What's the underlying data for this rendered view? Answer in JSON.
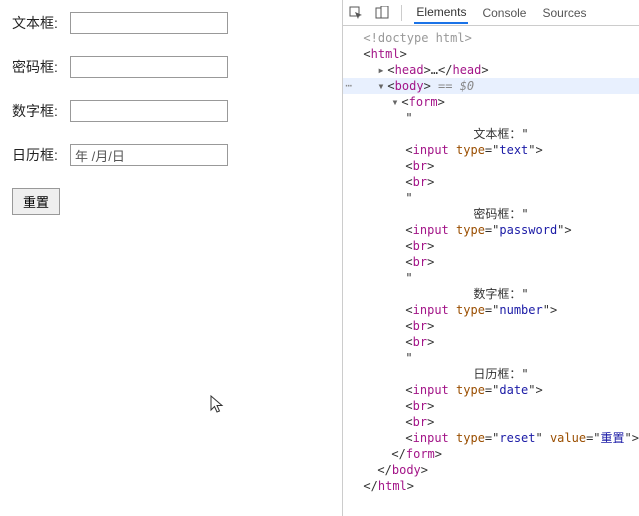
{
  "form": {
    "labels": {
      "text": "文本框:",
      "password": "密码框:",
      "number": "数字框:",
      "date": "日历框:"
    },
    "date_placeholder": "年 /月/日",
    "reset_label": "重置"
  },
  "devtools": {
    "tabs": {
      "elements": "Elements",
      "console": "Console",
      "sources": "Sources"
    },
    "tree": {
      "doctype": "<!doctype html>",
      "html_open": "html",
      "head_open": "head",
      "head_ellipsis": "…",
      "head_close": "head",
      "body_open": "body",
      "eq0": " == $0",
      "form_open": "form",
      "quote": "\"",
      "t_text_label": "文本框：\"",
      "t_pass_label": "密码框：\"",
      "t_num_label": "数字框：\"",
      "t_date_label": "日历框：\"",
      "br": "br",
      "input_tag": "input",
      "attr_type": "type",
      "val_text": "text",
      "val_password": "password",
      "val_number": "number",
      "val_date": "date",
      "val_reset": "reset",
      "attr_value": "value",
      "val_resetlabel": "重置",
      "form_close": "form",
      "body_close": "body",
      "html_close": "html"
    }
  }
}
